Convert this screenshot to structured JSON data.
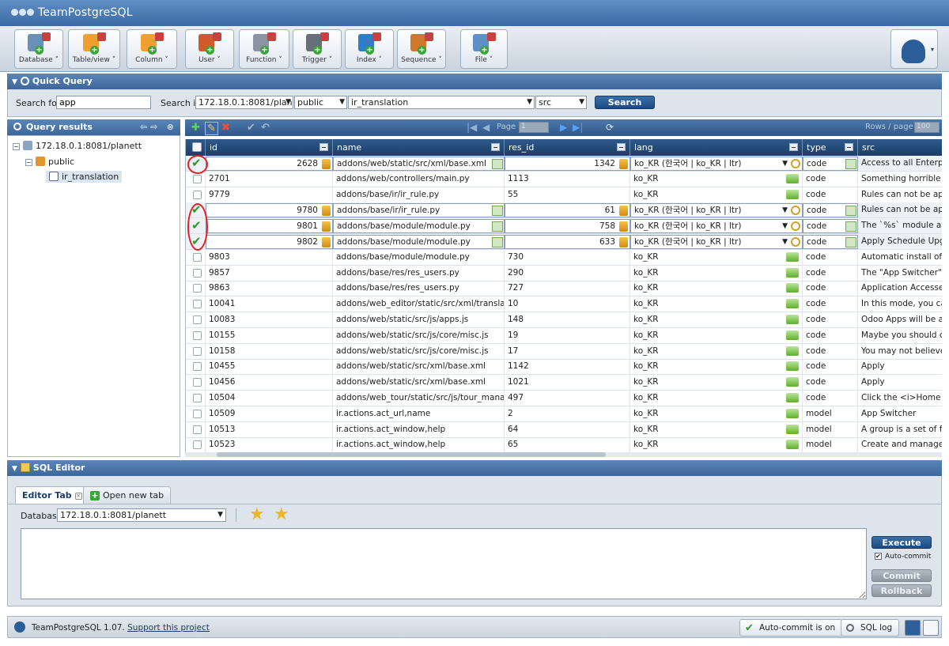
{
  "app": {
    "title": "TeamPostgreSQL"
  },
  "toolbar": {
    "buttons": [
      {
        "label": "Database ˅",
        "color": "#6c8fb8"
      },
      {
        "label": "Table/view ˅",
        "color": "#f0a030"
      },
      {
        "label": "Column ˅",
        "color": "#f0a030"
      },
      {
        "label": "User ˅",
        "color": "#d05a2a"
      },
      {
        "label": "Function ˅",
        "color": "#8a94a2"
      },
      {
        "label": "Trigger ˅",
        "color": "#6a6e78"
      },
      {
        "label": "Index ˅",
        "color": "#2f7cc8"
      },
      {
        "label": "Sequence ˅",
        "color": "#d0782a"
      },
      {
        "label": "File ˅",
        "color": "#5f8fc4"
      }
    ]
  },
  "quick_query": {
    "title": "Quick Query",
    "search_for_label": "Search for",
    "search_for_value": "app",
    "search_in_label": "Search in",
    "server": "172.18.0.1:8081/planett",
    "schema": "public",
    "table": "ir_translation",
    "column": "src",
    "search_button": "Search"
  },
  "tree": {
    "title": "Query results",
    "server": "172.18.0.1:8081/planett",
    "schema": "public",
    "table": "ir_translation"
  },
  "grid": {
    "page_label": "Page",
    "page_value": "1",
    "rows_label": "Rows / page",
    "rows_value": "100",
    "columns": [
      "id",
      "name",
      "res_id",
      "lang",
      "type",
      "src"
    ],
    "lang_edit_value": "ko_KR (한국어 | ko_KR | ltr)",
    "rows": [
      {
        "checked": true,
        "editing": true,
        "id": "2628",
        "name": "addons/web/static/src/xml/base.xml",
        "res_id": "1342",
        "lang": "ko_KR",
        "type": "code",
        "src": "Access to all Enterprise"
      },
      {
        "checked": false,
        "editing": false,
        "id": "2701",
        "name": "addons/web/controllers/main.py",
        "res_id": "1113",
        "lang": "ko_KR",
        "type": "code",
        "src": "Something horrible happ"
      },
      {
        "checked": false,
        "editing": false,
        "id": "9779",
        "name": "addons/base/ir/ir_rule.py",
        "res_id": "55",
        "lang": "ko_KR",
        "type": "code",
        "src": "Rules can not be applied"
      },
      {
        "checked": true,
        "editing": true,
        "id": "9780",
        "name": "addons/base/ir/ir_rule.py",
        "res_id": "61",
        "lang": "ko_KR",
        "type": "code",
        "src": "Rules can not be applied"
      },
      {
        "checked": true,
        "editing": true,
        "id": "9801",
        "name": "addons/base/module/module.py",
        "res_id": "758",
        "lang": "ko_KR",
        "type": "code",
        "src": "The `%s` module appe"
      },
      {
        "checked": true,
        "editing": true,
        "id": "9802",
        "name": "addons/base/module/module.py",
        "res_id": "633",
        "lang": "ko_KR",
        "type": "code",
        "src": "Apply Schedule Upgrade"
      },
      {
        "checked": false,
        "editing": false,
        "id": "9803",
        "name": "addons/base/module/module.py",
        "res_id": "730",
        "lang": "ko_KR",
        "type": "code",
        "src": "Automatic install of dow"
      },
      {
        "checked": false,
        "editing": false,
        "id": "9857",
        "name": "addons/base/res/res_users.py",
        "res_id": "290",
        "lang": "ko_KR",
        "type": "code",
        "src": "The \"App Switcher\" actio"
      },
      {
        "checked": false,
        "editing": false,
        "id": "9863",
        "name": "addons/base/res/res_users.py",
        "res_id": "727",
        "lang": "ko_KR",
        "type": "code",
        "src": "Application Accesses"
      },
      {
        "checked": false,
        "editing": false,
        "id": "10041",
        "name": "addons/web_editor/static/src/xml/translator.xml",
        "res_id": "10",
        "lang": "ko_KR",
        "type": "code",
        "src": "In this mode, you can o"
      },
      {
        "checked": false,
        "editing": false,
        "id": "10083",
        "name": "addons/web/static/src/js/apps.js",
        "res_id": "148",
        "lang": "ko_KR",
        "type": "code",
        "src": "Odoo Apps will be availa"
      },
      {
        "checked": false,
        "editing": false,
        "id": "10155",
        "name": "addons/web/static/src/js/core/misc.js",
        "res_id": "19",
        "lang": "ko_KR",
        "type": "code",
        "src": "Maybe you should consi"
      },
      {
        "checked": false,
        "editing": false,
        "id": "10158",
        "name": "addons/web/static/src/js/core/misc.js",
        "res_id": "17",
        "lang": "ko_KR",
        "type": "code",
        "src": "You may not believe it, <"
      },
      {
        "checked": false,
        "editing": false,
        "id": "10455",
        "name": "addons/web/static/src/xml/base.xml",
        "res_id": "1142",
        "lang": "ko_KR",
        "type": "code",
        "src": "Apply"
      },
      {
        "checked": false,
        "editing": false,
        "id": "10456",
        "name": "addons/web/static/src/xml/base.xml",
        "res_id": "1021",
        "lang": "ko_KR",
        "type": "code",
        "src": "Apply"
      },
      {
        "checked": false,
        "editing": false,
        "id": "10504",
        "name": "addons/web_tour/static/src/js/tour_manager.js",
        "res_id": "497",
        "lang": "ko_KR",
        "type": "code",
        "src": "Click the <i>Home icon<"
      },
      {
        "checked": false,
        "editing": false,
        "id": "10509",
        "name": "ir.actions.act_url,name",
        "res_id": "2",
        "lang": "ko_KR",
        "type": "model",
        "src": "App Switcher"
      },
      {
        "checked": false,
        "editing": false,
        "id": "10513",
        "name": "ir.actions.act_window,help",
        "res_id": "64",
        "lang": "ko_KR",
        "type": "model",
        "src": "A group is a set of funct"
      },
      {
        "checked": false,
        "editing": false,
        "id": "10523",
        "name": "ir.actions.act_window,help",
        "res_id": "65",
        "lang": "ko_KR",
        "type": "model",
        "src": "Create and manage user"
      }
    ]
  },
  "sql_editor": {
    "title": "SQL Editor",
    "tab_label": "Editor Tab",
    "new_tab_label": "Open new tab",
    "database_label": "Database",
    "database_value": "172.18.0.1:8081/planett",
    "execute": "Execute",
    "autocommit": "Auto-commit",
    "commit": "Commit",
    "rollback": "Rollback"
  },
  "status": {
    "version": "TeamPostgreSQL 1.07.",
    "support": "Support this project",
    "autocommit_status": "Auto-commit is on",
    "sql_log": "SQL log"
  }
}
